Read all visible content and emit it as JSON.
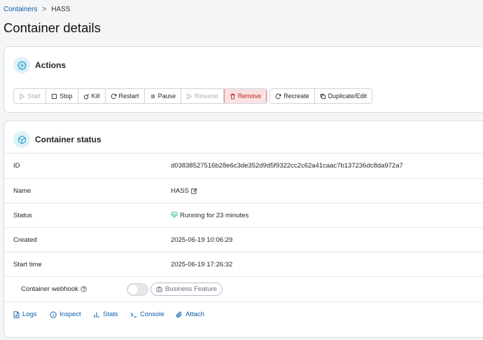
{
  "breadcrumb": {
    "parent": "Containers",
    "separator": ">",
    "current": "HASS"
  },
  "page_title": "Container details",
  "actions_card": {
    "title": "Actions",
    "buttons": {
      "start": "Start",
      "stop": "Stop",
      "kill": "Kill",
      "restart": "Restart",
      "pause": "Pause",
      "resume": "Resume",
      "remove": "Remove",
      "recreate": "Recreate",
      "duplicate": "Duplicate/Edit"
    }
  },
  "status_card": {
    "title": "Container status",
    "rows": [
      {
        "label": "ID",
        "value": "d03838527516b28e6c3de352d9d5f9322cc2c62a41caac7b137236dc8da972a7"
      },
      {
        "label": "Name",
        "value": "HASS"
      },
      {
        "label": "Status",
        "value": "Running for 23 minutes"
      },
      {
        "label": "Created",
        "value": "2025-06-19 10:06:29"
      },
      {
        "label": "Start time",
        "value": "2025-06-19 17:26:32"
      }
    ],
    "webhook": {
      "label": "Container webhook",
      "enabled": false,
      "badge": "Business Feature"
    },
    "links": {
      "logs": "Logs",
      "inspect": "Inspect",
      "stats": "Stats",
      "console": "Console",
      "attach": "Attach"
    }
  },
  "colors": {
    "link": "#0b5cab",
    "accent": "#2a9fc9",
    "danger": "#b42318",
    "running": "#2fb58a"
  }
}
